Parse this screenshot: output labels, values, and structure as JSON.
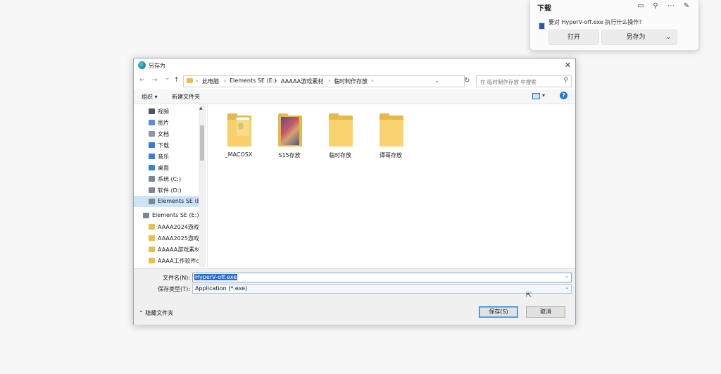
{
  "download_panel": {
    "title": "下载",
    "question": "要对 HyperV-off.exe 执行什么操作?",
    "open_label": "打开",
    "save_as_label": "另存为",
    "icons": [
      "folder-icon",
      "search-icon",
      "more-icon",
      "pin-icon"
    ]
  },
  "dialog": {
    "title": "另存为",
    "close_glyph": "✕",
    "nav": {
      "back": "←",
      "forward": "→",
      "recent": "⌄",
      "up": "↑",
      "refresh": "↻"
    },
    "breadcrumb": [
      "此电脑",
      "Elements SE (E:)",
      "AAAAA游戏素材",
      "临时制作存放"
    ],
    "search_placeholder": "在 临时制作存放 中搜索",
    "toolbar": {
      "organize": "组织 ▾",
      "new_folder": "新建文件夹"
    },
    "sidebar": [
      {
        "label": "视频",
        "color": "#4a5566"
      },
      {
        "label": "图片",
        "color": "#5b8fd1"
      },
      {
        "label": "文档",
        "color": "#8a96a6"
      },
      {
        "label": "下载",
        "color": "#2f7be0"
      },
      {
        "label": "音乐",
        "color": "#3b7fd9"
      },
      {
        "label": "桌面",
        "color": "#2f86d6"
      },
      {
        "label": "系统 (C:)",
        "color": "#7b8796"
      },
      {
        "label": "软件 (D:)",
        "color": "#7b8796"
      },
      {
        "label": "Elements SE (E:)",
        "color": "#7b8796",
        "selected": true
      },
      {
        "label": "Elements SE (E:)",
        "color": "#7b8796"
      },
      {
        "label": "AAAA2024游戏",
        "color": "#e8bf4b"
      },
      {
        "label": "AAAA2025游戏",
        "color": "#e8bf4b"
      },
      {
        "label": "AAAAA游戏素材",
        "color": "#e8bf4b"
      },
      {
        "label": "AAAA工作软件d",
        "color": "#e8bf4b"
      }
    ],
    "folders": [
      "_MACOSX",
      "S15存放",
      "临时存放",
      "谭哥存放"
    ],
    "filename_label": "文件名(N):",
    "filename_value": "HyperV-off.exe",
    "filetype_label": "保存类型(T):",
    "filetype_value": "Application (*.exe)",
    "hide_folders": "⌃ 隐藏文件夹",
    "save_button": "保存(S)",
    "cancel_button": "取消"
  }
}
